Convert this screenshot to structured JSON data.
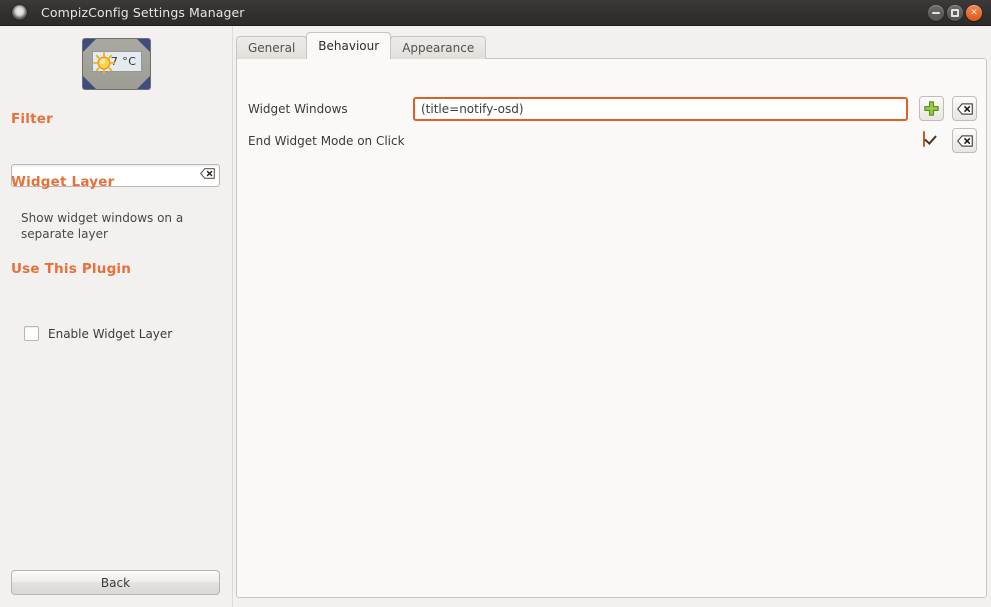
{
  "window": {
    "title": "CompizConfig Settings Manager",
    "app_icon": "app-circle-icon",
    "buttons": {
      "minimize": "minimize-icon",
      "maximize": "maximize-icon",
      "close": "close-icon"
    }
  },
  "colors": {
    "titlebar_bg": "#332f2d",
    "close_button": "#e2571d",
    "accent_orange": "#e8703a",
    "entry_focus_border": "#e06024",
    "checkbox_on": "#e8753a",
    "panel_bg": "#faf9f7",
    "sidebar_bg": "#f2f1ef",
    "plus_green": "#8cbf3f"
  },
  "sidebar": {
    "plugin_icon": {
      "name": "widget-layer-plugin-icon",
      "display_text": "7 °C"
    },
    "filter": {
      "heading": "Filter",
      "value": "",
      "placeholder": "",
      "clear_icon": "clear-entry-icon"
    },
    "widget_layer": {
      "heading": "Widget Layer",
      "description": "Show widget windows on a separate layer"
    },
    "use_this_plugin": {
      "heading": "Use This Plugin",
      "checkbox_label": "Enable Widget Layer",
      "checked": false
    },
    "back_button": "Back"
  },
  "main": {
    "tabs": [
      {
        "label": "General",
        "active": false
      },
      {
        "label": "Behaviour",
        "active": true
      },
      {
        "label": "Appearance",
        "active": false
      }
    ],
    "settings": [
      {
        "label": "Widget Windows",
        "type": "text",
        "value": "(title=notify-osd)",
        "placeholder": "",
        "add_button_icon": "plus-icon",
        "reset_button_icon": "reset-icon"
      },
      {
        "label": "End Widget Mode on Click",
        "type": "checkbox",
        "checked": true,
        "reset_button_icon": "reset-icon"
      }
    ]
  }
}
